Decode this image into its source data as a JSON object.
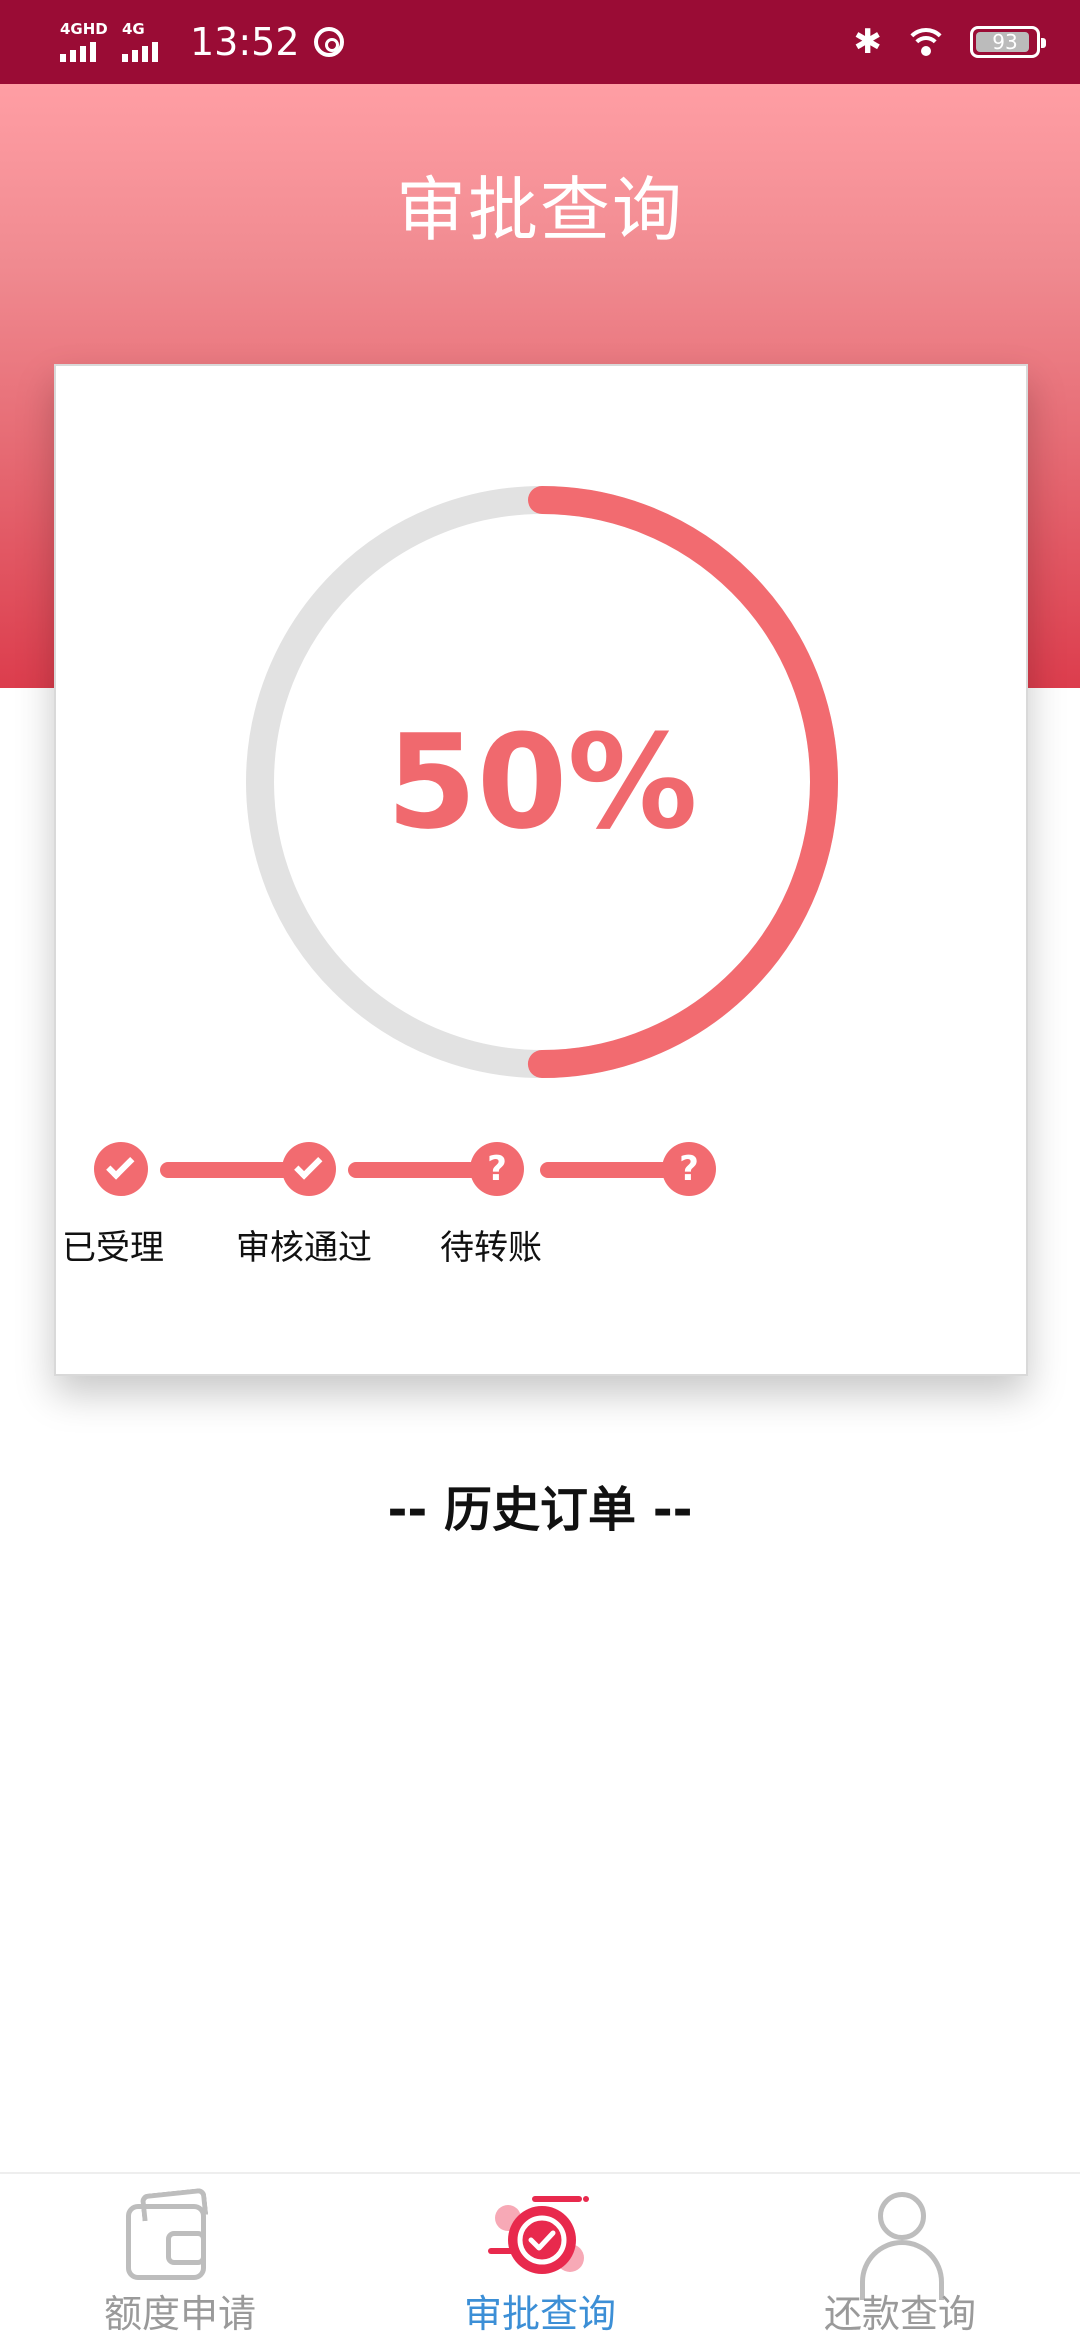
{
  "status_bar": {
    "signal1_label": "4GHD",
    "signal2_label": "4G",
    "time": "13:52",
    "battery": "93"
  },
  "header": {
    "title": "审批查询"
  },
  "progress": {
    "percent_label": "50%",
    "value": 0.5,
    "colors": {
      "accent": "#f26b70",
      "track": "#e2e2e2"
    }
  },
  "steps": [
    {
      "label": "已受理",
      "status": "done"
    },
    {
      "label": "审核通过",
      "status": "done"
    },
    {
      "label": "待转账",
      "status": "pending"
    },
    {
      "label": "",
      "status": "pending"
    }
  ],
  "step_pending_symbol": "?",
  "history": {
    "title": "-- 历史订单 --"
  },
  "bottom_nav": {
    "items": [
      {
        "label": "额度申请",
        "icon": "wallet-icon",
        "active": false
      },
      {
        "label": "审批查询",
        "icon": "approve-check-icon",
        "active": true
      },
      {
        "label": "还款查询",
        "icon": "user-icon",
        "active": false
      }
    ],
    "active_color": "#3c8fd6",
    "inactive_color": "#9a9a9a"
  }
}
